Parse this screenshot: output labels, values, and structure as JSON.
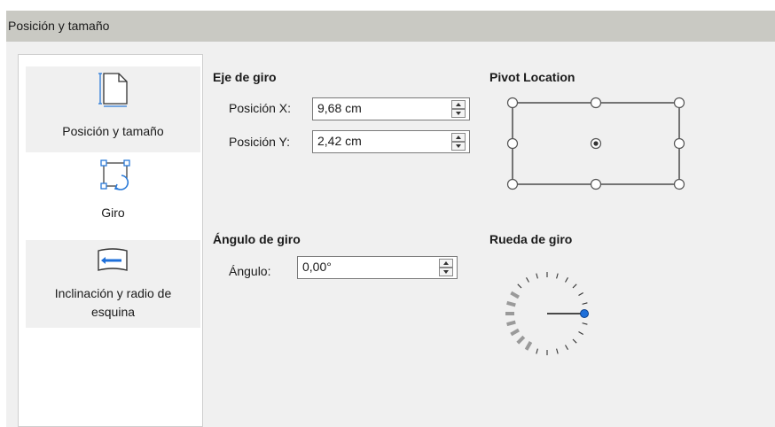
{
  "window": {
    "title": "Posición y tamaño"
  },
  "sidebar": {
    "items": [
      {
        "label": "Posición y tamaño",
        "icon": "page-size-icon",
        "active": false
      },
      {
        "label": "Giro",
        "icon": "rotate-icon",
        "active": true
      },
      {
        "label": "Inclinación y radio de esquina",
        "label_line1": "Inclinación y radio de",
        "label_line2": "esquina",
        "icon": "slant-icon",
        "active": false
      }
    ]
  },
  "pivot": {
    "title": "Eje de giro",
    "pos_x_label": "Posición X:",
    "pos_x_value": "9,68 cm",
    "pos_y_label": "Posición Y:",
    "pos_y_value": "2,42 cm"
  },
  "pivot_location": {
    "title": "Pivot Location",
    "selected": "center"
  },
  "angle": {
    "title": "Ángulo de giro",
    "label": "Ángulo:",
    "value": "0,00°"
  },
  "dial": {
    "title": "Rueda de giro",
    "angle_degrees": 0
  },
  "colors": {
    "titlebar": "#c9c9c3",
    "panel": "#f0f0f0",
    "accent": "#1e6fd9"
  }
}
